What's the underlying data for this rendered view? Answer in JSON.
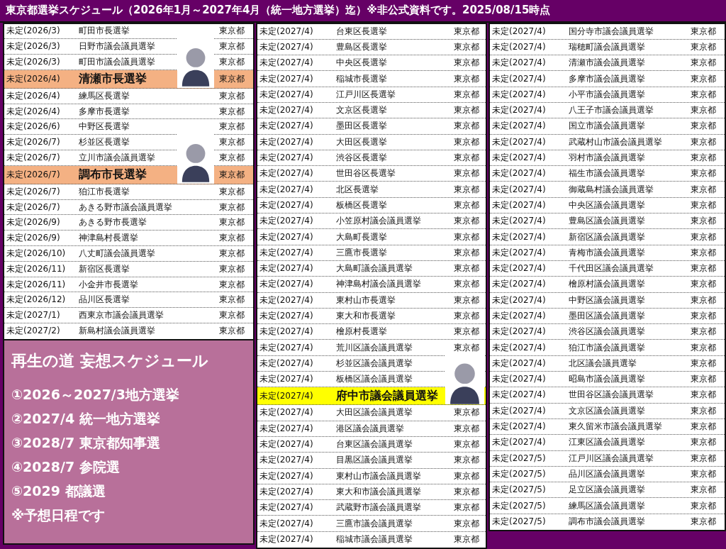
{
  "title": "東京都選挙スケジュール（2026年1月～2027年4月（統一地方選挙）迄）※非公式資料です。2025/08/15時点",
  "columns": [
    {
      "rows": [
        {
          "date": "未定(2026/3)",
          "name": "町田市長選挙",
          "place": "東京都"
        },
        {
          "date": "未定(2026/3)",
          "name": "日野市議会議員選挙",
          "place": "東京都"
        },
        {
          "date": "未定(2026/3)",
          "name": "町田市議会議員選挙",
          "place": "東京都"
        },
        {
          "date": "未定(2026/4)",
          "name": "清瀬市長選挙",
          "place": "東京都",
          "color": "#f4b183",
          "avatar": true
        },
        {
          "date": "未定(2026/4)",
          "name": "練馬区長選挙",
          "place": "東京都"
        },
        {
          "date": "未定(2026/4)",
          "name": "多摩市長選挙",
          "place": "東京都"
        },
        {
          "date": "未定(2026/6)",
          "name": "中野区長選挙",
          "place": "東京都"
        },
        {
          "date": "未定(2026/7)",
          "name": "杉並区長選挙",
          "place": "東京都"
        },
        {
          "date": "未定(2026/7)",
          "name": "立川市議会議員選挙",
          "place": "東京都"
        },
        {
          "date": "未定(2026/7)",
          "name": "調布市長選挙",
          "place": "東京都",
          "color": "#f4b183",
          "avatar": true
        },
        {
          "date": "未定(2026/7)",
          "name": "狛江市長選挙",
          "place": "東京都"
        },
        {
          "date": "未定(2026/7)",
          "name": "あきる野市議会議員選挙",
          "place": "東京都"
        },
        {
          "date": "未定(2026/9)",
          "name": "あきる野市長選挙",
          "place": "東京都"
        },
        {
          "date": "未定(2026/9)",
          "name": "神津島村長選挙",
          "place": "東京都"
        },
        {
          "date": "未定(2026/10)",
          "name": "八丈町議会議員選挙",
          "place": "東京都"
        },
        {
          "date": "未定(2026/11)",
          "name": "新宿区長選挙",
          "place": "東京都"
        },
        {
          "date": "未定(2026/11)",
          "name": "小金井市長選挙",
          "place": "東京都"
        },
        {
          "date": "未定(2026/12)",
          "name": "品川区長選挙",
          "place": "東京都"
        },
        {
          "date": "未定(2027/1)",
          "name": "西東京市議会議員選挙",
          "place": "東京都"
        },
        {
          "date": "未定(2027/2)",
          "name": "新島村議会議員選挙",
          "place": "東京都"
        }
      ]
    },
    {
      "rows": [
        {
          "date": "未定(2027/4)",
          "name": "台東区長選挙",
          "place": "東京都"
        },
        {
          "date": "未定(2027/4)",
          "name": "豊島区長選挙",
          "place": "東京都"
        },
        {
          "date": "未定(2027/4)",
          "name": "中央区長選挙",
          "place": "東京都"
        },
        {
          "date": "未定(2027/4)",
          "name": "稲城市長選挙",
          "place": "東京都"
        },
        {
          "date": "未定(2027/4)",
          "name": "江戸川区長選挙",
          "place": "東京都"
        },
        {
          "date": "未定(2027/4)",
          "name": "文京区長選挙",
          "place": "東京都"
        },
        {
          "date": "未定(2027/4)",
          "name": "墨田区長選挙",
          "place": "東京都"
        },
        {
          "date": "未定(2027/4)",
          "name": "大田区長選挙",
          "place": "東京都"
        },
        {
          "date": "未定(2027/4)",
          "name": "渋谷区長選挙",
          "place": "東京都"
        },
        {
          "date": "未定(2027/4)",
          "name": "世田谷区長選挙",
          "place": "東京都"
        },
        {
          "date": "未定(2027/4)",
          "name": "北区長選挙",
          "place": "東京都"
        },
        {
          "date": "未定(2027/4)",
          "name": "板橋区長選挙",
          "place": "東京都"
        },
        {
          "date": "未定(2027/4)",
          "name": "小笠原村議会議員選挙",
          "place": "東京都"
        },
        {
          "date": "未定(2027/4)",
          "name": "大島町長選挙",
          "place": "東京都"
        },
        {
          "date": "未定(2027/4)",
          "name": "三鷹市長選挙",
          "place": "東京都"
        },
        {
          "date": "未定(2027/4)",
          "name": "大島町議会議員選挙",
          "place": "東京都"
        },
        {
          "date": "未定(2027/4)",
          "name": "神津島村議会議員選挙",
          "place": "東京都"
        },
        {
          "date": "未定(2027/4)",
          "name": "東村山市長選挙",
          "place": "東京都"
        },
        {
          "date": "未定(2027/4)",
          "name": "東大和市長選挙",
          "place": "東京都"
        },
        {
          "date": "未定(2027/4)",
          "name": "檜原村長選挙",
          "place": "東京都"
        },
        {
          "date": "未定(2027/4)",
          "name": "荒川区議会議員選挙",
          "place": "東京都"
        },
        {
          "date": "未定(2027/4)",
          "name": "杉並区議会議員選挙"
        },
        {
          "date": "未定(2027/4)",
          "name": "板橋区議会議員選挙"
        },
        {
          "date": "未定(2027/4)",
          "name": "府中市議会議員選挙",
          "color": "#ffff00",
          "avatar": true
        },
        {
          "date": "未定(2027/4)",
          "name": "大田区議会議員選挙",
          "place": "東京都"
        },
        {
          "date": "未定(2027/4)",
          "name": "港区議会議員選挙",
          "place": "東京都"
        },
        {
          "date": "未定(2027/4)",
          "name": "台東区議会議員選挙",
          "place": "東京都"
        },
        {
          "date": "未定(2027/4)",
          "name": "目黒区議会議員選挙",
          "place": "東京都"
        },
        {
          "date": "未定(2027/4)",
          "name": "東村山市議会議員選挙",
          "place": "東京都"
        },
        {
          "date": "未定(2027/4)",
          "name": "東大和市議会議員選挙",
          "place": "東京都"
        },
        {
          "date": "未定(2027/4)",
          "name": "武蔵野市議会議員選挙",
          "place": "東京都"
        },
        {
          "date": "未定(2027/4)",
          "name": "三鷹市議会議員選挙",
          "place": "東京都"
        },
        {
          "date": "未定(2027/4)",
          "name": "稲城市議会議員選挙",
          "place": "東京都"
        }
      ]
    },
    {
      "rows": [
        {
          "date": "未定(2027/4)",
          "name": "国分寺市議会議員選挙",
          "place": "東京都"
        },
        {
          "date": "未定(2027/4)",
          "name": "瑞穂町議会議員選挙",
          "place": "東京都"
        },
        {
          "date": "未定(2027/4)",
          "name": "清瀬市議会議員選挙",
          "place": "東京都"
        },
        {
          "date": "未定(2027/4)",
          "name": "多摩市議会議員選挙",
          "place": "東京都"
        },
        {
          "date": "未定(2027/4)",
          "name": "小平市議会議員選挙",
          "place": "東京都"
        },
        {
          "date": "未定(2027/4)",
          "name": "八王子市議会議員選挙",
          "place": "東京都"
        },
        {
          "date": "未定(2027/4)",
          "name": "国立市議会議員選挙",
          "place": "東京都"
        },
        {
          "date": "未定(2027/4)",
          "name": "武蔵村山市議会議員選挙",
          "place": "東京都"
        },
        {
          "date": "未定(2027/4)",
          "name": "羽村市議会議員選挙",
          "place": "東京都"
        },
        {
          "date": "未定(2027/4)",
          "name": "福生市議会議員選挙",
          "place": "東京都"
        },
        {
          "date": "未定(2027/4)",
          "name": "御蔵島村議会議員選挙",
          "place": "東京都"
        },
        {
          "date": "未定(2027/4)",
          "name": "中央区議会議員選挙",
          "place": "東京都"
        },
        {
          "date": "未定(2027/4)",
          "name": "豊島区議会議員選挙",
          "place": "東京都"
        },
        {
          "date": "未定(2027/4)",
          "name": "新宿区議会議員選挙",
          "place": "東京都"
        },
        {
          "date": "未定(2027/4)",
          "name": "青梅市議会議員選挙",
          "place": "東京都"
        },
        {
          "date": "未定(2027/4)",
          "name": "千代田区議会議員選挙",
          "place": "東京都"
        },
        {
          "date": "未定(2027/4)",
          "name": "檜原村議会議員選挙",
          "place": "東京都"
        },
        {
          "date": "未定(2027/4)",
          "name": "中野区議会議員選挙",
          "place": "東京都"
        },
        {
          "date": "未定(2027/4)",
          "name": "墨田区議会議員選挙",
          "place": "東京都"
        },
        {
          "date": "未定(2027/4)",
          "name": "渋谷区議会議員選挙",
          "place": "東京都"
        },
        {
          "date": "未定(2027/4)",
          "name": "狛江市議会議員選挙",
          "place": "東京都"
        },
        {
          "date": "未定(2027/4)",
          "name": "北区議会議員選挙",
          "place": "東京都"
        },
        {
          "date": "未定(2027/4)",
          "name": "昭島市議会議員選挙",
          "place": "東京都"
        },
        {
          "date": "未定(2027/4)",
          "name": "世田谷区議会議員選挙",
          "place": "東京都"
        },
        {
          "date": "未定(2027/4)",
          "name": "文京区議会議員選挙",
          "place": "東京都"
        },
        {
          "date": "未定(2027/4)",
          "name": "東久留米市議会議員選挙",
          "place": "東京都"
        },
        {
          "date": "未定(2027/4)",
          "name": "江東区議会議員選挙",
          "place": "東京都"
        },
        {
          "date": "未定(2027/5)",
          "name": "江戸川区議会議員選挙",
          "place": "東京都"
        },
        {
          "date": "未定(2027/5)",
          "name": "品川区議会議員選挙",
          "place": "東京都"
        },
        {
          "date": "未定(2027/5)",
          "name": "足立区議会議員選挙",
          "place": "東京都"
        },
        {
          "date": "未定(2027/5)",
          "name": "練馬区議会議員選挙",
          "place": "東京都"
        },
        {
          "date": "未定(2027/5)",
          "name": "調布市議会議員選挙",
          "place": "東京都"
        }
      ]
    }
  ],
  "panel": {
    "title": "再生の道 妄想スケジュール",
    "items": [
      "①2026～2027/3地方選挙",
      "②2027/4 統一地方選挙",
      "③2028/7 東京都知事選",
      "④2028/7 参院選",
      "⑤2029 都議選",
      "※予想日程です"
    ]
  }
}
